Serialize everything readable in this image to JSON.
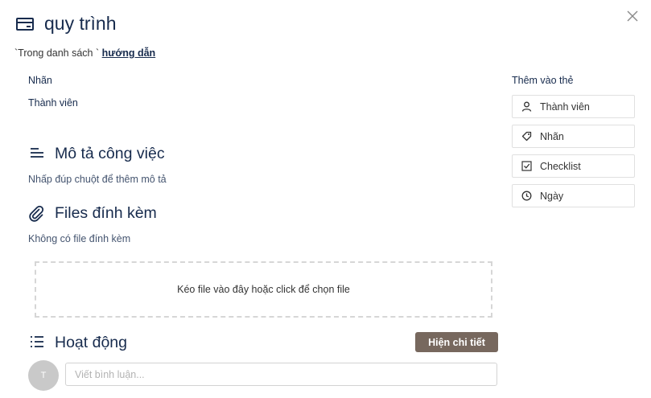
{
  "card": {
    "title": "quy trình",
    "list_prefix": "`Trong danh sách `",
    "list_name": "hướng dẫn",
    "icon": "card-icon"
  },
  "fields": {
    "labels_label": "Nhãn",
    "members_label": "Thành viên"
  },
  "description": {
    "title": "Mô tả công việc",
    "placeholder": "Nhấp đúp chuột để thêm mô tả",
    "icon": "description-icon"
  },
  "attachments": {
    "title": "Files đính kèm",
    "empty_text": "Không có file đính kèm",
    "dropzone_text": "Kéo file vào đây hoặc click để chọn file",
    "icon": "paperclip-icon"
  },
  "activity": {
    "title": "Hoạt động",
    "detail_button": "Hiện chi tiết",
    "avatar_initial": "T",
    "comment_placeholder": "Viết bình luận...",
    "icon": "activity-list-icon"
  },
  "sidebar": {
    "heading": "Thêm vào thẻ",
    "buttons": [
      {
        "label": "Thành viên",
        "icon": "user-icon"
      },
      {
        "label": "Nhãn",
        "icon": "tag-icon"
      },
      {
        "label": "Checklist",
        "icon": "checkbox-icon"
      },
      {
        "label": "Ngày",
        "icon": "clock-icon"
      }
    ]
  },
  "colors": {
    "detail_button_bg": "#77685e",
    "text_primary": "#172b4d",
    "avatar_bg": "#c9c9c9"
  }
}
